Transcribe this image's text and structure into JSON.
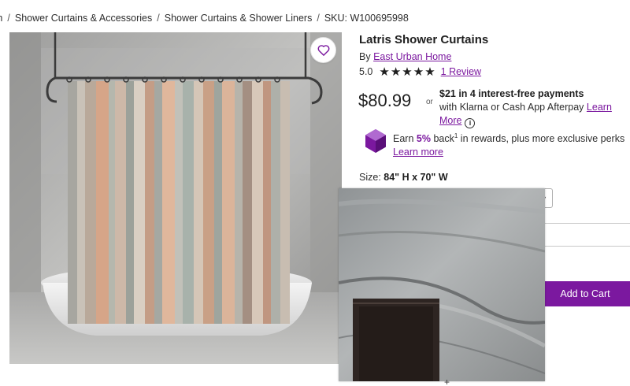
{
  "breadcrumb": {
    "items": [
      "ath",
      "Shower Curtains & Accessories",
      "Shower Curtains & Shower Liners"
    ],
    "separator": "/",
    "sku": "SKU: W100695998"
  },
  "product": {
    "title": "Latris Shower Curtains",
    "by_prefix": "By",
    "brand": "East Urban Home",
    "rating": "5.0",
    "star_count": 5,
    "review_link": "1 Review",
    "image_icon": "favorite-heart-icon"
  },
  "pricing": {
    "price": "$80.99",
    "or": "or",
    "installment_bold": "$21 in 4 interest-free payments",
    "installment_text": "with Klarna or Cash App Afterpay",
    "learn_more": "Learn More",
    "info_glyph": "i"
  },
  "rewards": {
    "earn": "Earn",
    "percent": "5%",
    "back": "back",
    "superscript": "1",
    "rest": "in rewards, plus more exclusive perks",
    "learn_more": "Learn more",
    "icon": "rewards-cube-icon"
  },
  "options": {
    "size_label": "Size:",
    "size_value": "84\" H x 70\" W",
    "select_icon": "chevron-down-icon"
  },
  "actions": {
    "add_to_cart": "Add to Cart"
  },
  "colors": {
    "accent": "#7b189f",
    "text": "#2d2d2d"
  },
  "bottom_glyph": "+"
}
